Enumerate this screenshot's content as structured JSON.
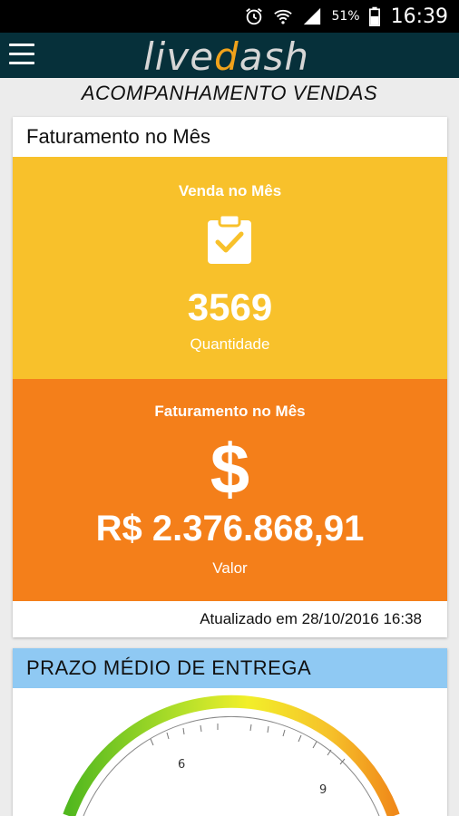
{
  "status_bar": {
    "battery_percent": "51%",
    "time": "16:39",
    "icons": [
      "alarm-icon",
      "wifi-icon",
      "signal-icon",
      "battery-icon"
    ]
  },
  "app_bar": {
    "menu_icon": "menu-icon",
    "logo_text_1": "live",
    "logo_text_2": "ash"
  },
  "page": {
    "title": "ACOMPANHAMENTO VENDAS"
  },
  "faturamento_card": {
    "header": "Faturamento no Mês",
    "sales_tile": {
      "label": "Venda no Mês",
      "icon": "clipboard-check-icon",
      "value": "3569",
      "sub_label": "Quantidade",
      "color": "#f8c12b"
    },
    "revenue_tile": {
      "label": "Faturamento no Mês",
      "icon": "dollar-icon",
      "icon_glyph": "$",
      "value": "R$ 2.376.868,91",
      "sub_label": "Valor",
      "color": "#f47f1a"
    },
    "updated": "Atualizado em 28/10/2016 16:38"
  },
  "prazo_card": {
    "header": "PRAZO MÉDIO DE ENTREGA",
    "header_color": "#8fc9f3",
    "gauge_ticks": [
      "6",
      "9"
    ]
  }
}
